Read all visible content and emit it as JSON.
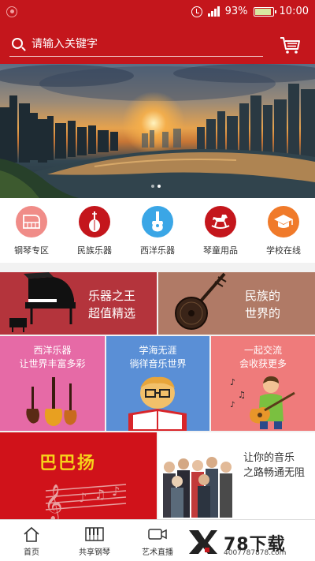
{
  "status_bar": {
    "battery": "93%",
    "time": "10:00",
    "signal": "4G"
  },
  "search": {
    "placeholder": "请输入关键字"
  },
  "banner": {
    "total_slides": 2,
    "active_slide": 1
  },
  "categories": [
    {
      "label": "钢琴专区",
      "icon": "piano-icon",
      "color": "#f08c88"
    },
    {
      "label": "民族乐器",
      "icon": "pipa-icon",
      "color": "#c4161c"
    },
    {
      "label": "西洋乐器",
      "icon": "guitar-icon",
      "color": "#3aa6e6"
    },
    {
      "label": "琴童用品",
      "icon": "rocking-horse-icon",
      "color": "#c4161c"
    },
    {
      "label": "学校在线",
      "icon": "graduation-cap-icon",
      "color": "#f07a2a"
    }
  ],
  "tiles": {
    "piano": {
      "line1": "乐器之王",
      "line2": "超值精选",
      "color": "#b4343c"
    },
    "folk": {
      "line1": "民族的",
      "line2": "世界的",
      "color": "#b07a66"
    },
    "western": {
      "line1": "西洋乐器",
      "line2": "让世界丰富多彩",
      "color": "#e66aa6"
    },
    "learn": {
      "line1": "学海无涯",
      "line2": "徜徉音乐世界",
      "color": "#5a8fd6"
    },
    "share": {
      "line1": "一起交流",
      "line2": "会收获更多",
      "color": "#ef7b7b"
    },
    "babayang": {
      "title": "巴巴扬",
      "color": "#d0121a"
    },
    "music_road": {
      "line1": "让你的音乐",
      "line2": "之路畅通无阻"
    }
  },
  "bottom_nav": [
    {
      "label": "首页",
      "icon": "home-icon"
    },
    {
      "label": "共享钢琴",
      "icon": "piano-keys-icon"
    },
    {
      "label": "艺术直播",
      "icon": "video-camera-icon"
    }
  ],
  "watermark": {
    "title": "78下载",
    "url": "4007787878.com"
  }
}
